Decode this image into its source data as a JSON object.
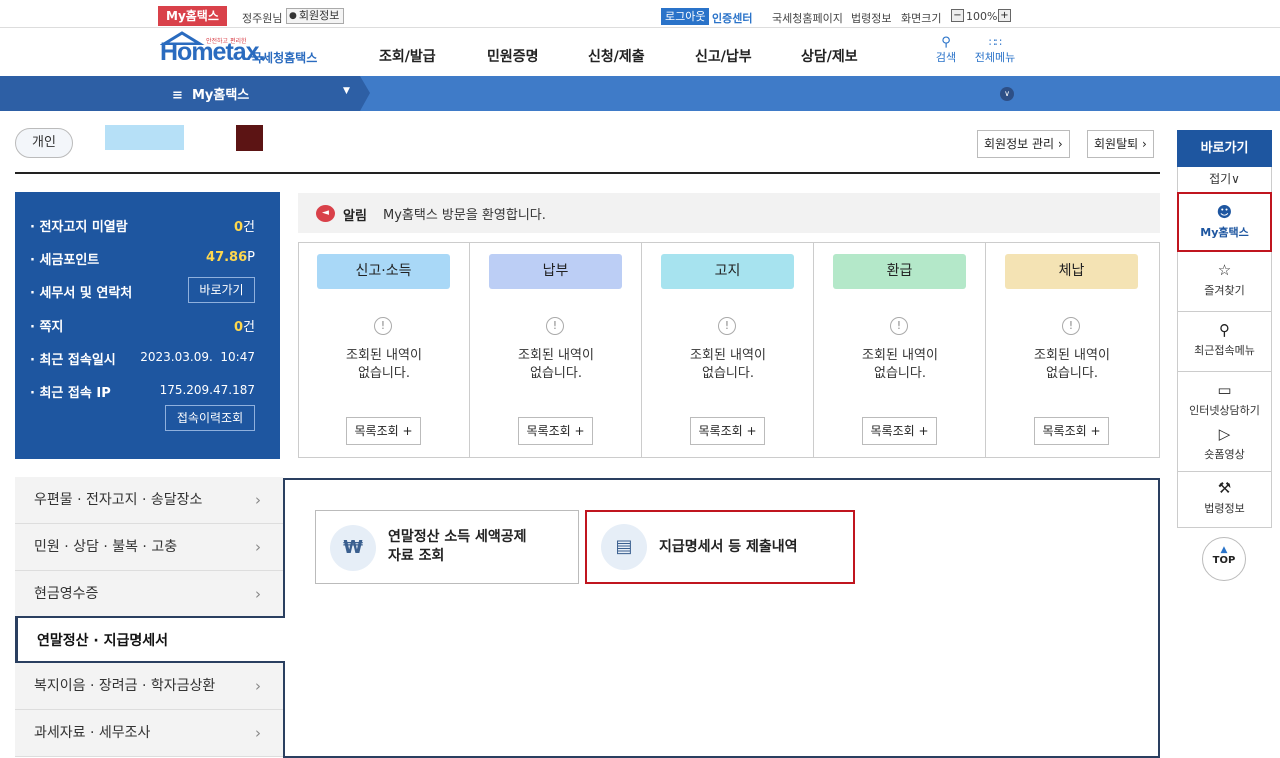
{
  "topbar": {
    "brand_tag": "My홈택스",
    "user_name": "정주원님",
    "member_info": "회원정보",
    "logout": "로그아웃",
    "cert_center": "인증센터",
    "nts_page": "국세청홈페이지",
    "law_info": "법령정보",
    "screen_size": "화면크기",
    "zoom_minus": "−",
    "zoom_value": "100%",
    "zoom_plus": "+"
  },
  "header": {
    "logo_small": "안전하고 편리한 세금 신고 납부 서비스",
    "logo_main": "Hometax.",
    "logo_sub": "국세청홈택스",
    "gnb": [
      "조회/발급",
      "민원증명",
      "신청/제출",
      "신고/납부",
      "상담/제보"
    ],
    "search": "검색",
    "all_menu": "전체메뉴"
  },
  "nav": {
    "current": "My홈택스"
  },
  "profile": {
    "type_tag": "개인",
    "member_manage": "회원정보 관리",
    "withdraw": "회원탈퇴"
  },
  "info_panel": {
    "rows": [
      {
        "label": "전자고지 미열람",
        "value": "0",
        "unit": "건"
      },
      {
        "label": "세금포인트",
        "value": "47.86",
        "unit": "P"
      },
      {
        "label": "세무서 및 연락처",
        "button": "바로가기"
      },
      {
        "label": "쪽지",
        "value": "0",
        "unit": "건"
      },
      {
        "label": "최근 접속일시",
        "value": "2023.03.09.  10:47"
      },
      {
        "label": "최근 접속 IP",
        "value": "175.209.47.187"
      }
    ],
    "history_button": "접속이력조회"
  },
  "notice": {
    "label": "알림",
    "text": "My홈택스 방문을 환영합니다."
  },
  "cards": [
    {
      "title": "신고·소득",
      "color": "#a9d8f7",
      "line1": "조회된 내역이",
      "line2": "없습니다.",
      "button": "목록조회 +"
    },
    {
      "title": "납부",
      "color": "#bccef5",
      "line1": "조회된 내역이",
      "line2": "없습니다.",
      "button": "목록조회 +"
    },
    {
      "title": "고지",
      "color": "#a7e3ef",
      "line1": "조회된 내역이",
      "line2": "없습니다.",
      "button": "목록조회 +"
    },
    {
      "title": "환급",
      "color": "#b4e8c9",
      "line1": "조회된 내역이",
      "line2": "없습니다.",
      "button": "목록조회 +"
    },
    {
      "title": "체납",
      "color": "#f4e3b4",
      "line1": "조회된 내역이",
      "line2": "없습니다.",
      "button": "목록조회 +"
    }
  ],
  "side_menu": [
    {
      "label": "우편물 · 전자고지 · 송달장소"
    },
    {
      "label": "민원 · 상담 · 불복 · 고충"
    },
    {
      "label": "현금영수증"
    },
    {
      "label": "연말정산 · 지급명세서"
    },
    {
      "label": "복지이음 · 장려금 · 학자금상환"
    },
    {
      "label": "과세자료 · 세무조사"
    }
  ],
  "content": {
    "btn1_line1": "연말정산 소득 세액공제",
    "btn1_line2": "자료 조회",
    "btn2": "지급명세서 등 제출내역"
  },
  "quickbar": {
    "title": "바로가기",
    "fold": "접기∨",
    "items": [
      {
        "label": "My홈택스",
        "icon": "person-icon"
      },
      {
        "label": "즐겨찾기",
        "icon": "star-icon"
      },
      {
        "label": "최근접속메뉴",
        "icon": "recent-icon"
      },
      {
        "label": "인터넷상담하기",
        "icon": "chat-icon"
      },
      {
        "label": "숏폼영상",
        "icon": "play-icon"
      },
      {
        "label": "법령정보",
        "icon": "gavel-icon"
      }
    ],
    "top": "TOP"
  },
  "colors": {
    "primary": "#1e56a0",
    "accent_red": "#c0151f",
    "nav": "#3f7bc8"
  }
}
